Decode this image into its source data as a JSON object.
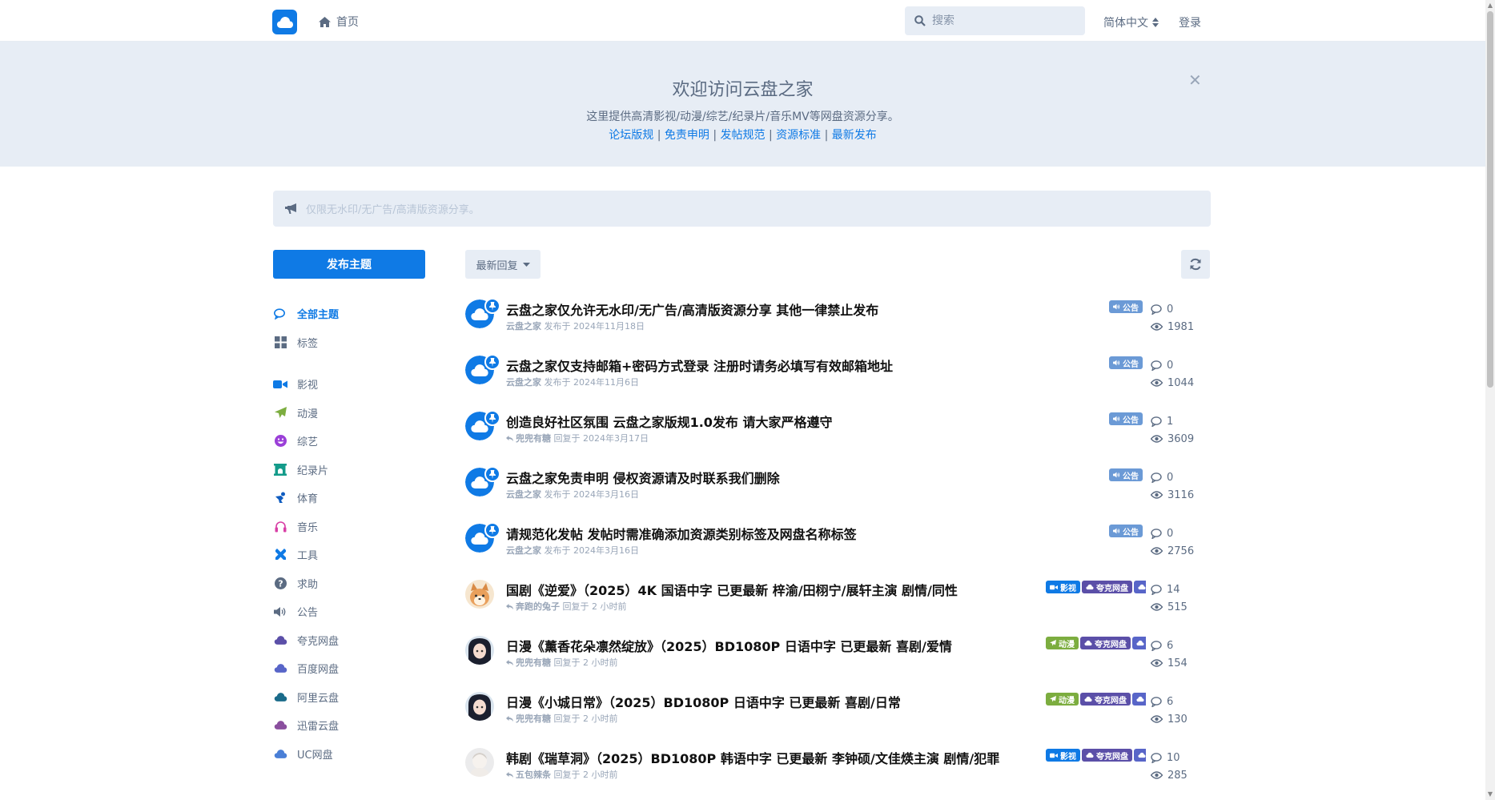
{
  "header": {
    "home_label": "首页",
    "search_placeholder": "搜索",
    "language": "简体中文",
    "login": "登录"
  },
  "hero": {
    "title": "欢迎访问云盘之家",
    "description": "这里提供高清影视/动漫/综艺/纪录片/音乐MV等网盘资源分享。",
    "links": [
      "论坛版规",
      "免责申明",
      "发帖规范",
      "资源标准",
      "最新发布"
    ],
    "separator": " | "
  },
  "announcement": {
    "text": "仅限无水印/无广告/高清版资源分享。"
  },
  "sidebar": {
    "new_topic": "发布主题",
    "items": [
      {
        "label": "全部主题",
        "icon": "comments-icon",
        "color": "#0f7ae5",
        "active": true
      },
      {
        "label": "标签",
        "icon": "grid-icon",
        "color": "#5b6b82"
      },
      {
        "label": "影视",
        "icon": "video-icon",
        "color": "#0f7ae5"
      },
      {
        "label": "动漫",
        "icon": "paper-plane-icon",
        "color": "#7cad3f"
      },
      {
        "label": "综艺",
        "icon": "laugh-icon",
        "color": "#9b3fd8"
      },
      {
        "label": "纪录片",
        "icon": "archway-icon",
        "color": "#139b8a"
      },
      {
        "label": "体育",
        "icon": "skating-icon",
        "color": "#0f5cc0"
      },
      {
        "label": "音乐",
        "icon": "headphones-icon",
        "color": "#d83fa6"
      },
      {
        "label": "工具",
        "icon": "tools-icon",
        "color": "#0f7ae5"
      },
      {
        "label": "求助",
        "icon": "question-icon",
        "color": "#5b6b82"
      },
      {
        "label": "公告",
        "icon": "volume-icon",
        "color": "#5b6b82"
      },
      {
        "label": "夸克网盘",
        "icon": "cloud-icon",
        "color": "#5b4fa8"
      },
      {
        "label": "百度网盘",
        "icon": "cloud-icon",
        "color": "#5865c8"
      },
      {
        "label": "阿里云盘",
        "icon": "cloud-icon",
        "color": "#1a6b8a"
      },
      {
        "label": "迅雷云盘",
        "icon": "cloud-icon",
        "color": "#8a4f9e"
      },
      {
        "label": "UC网盘",
        "icon": "cloud-icon",
        "color": "#4a7fd6"
      }
    ]
  },
  "toolbar": {
    "sort_label": "最新回复"
  },
  "tag_labels": {
    "announce": "公告",
    "movie": "影视",
    "anime": "动漫",
    "quark": "夸克网盘",
    "baidu": "百度网盘"
  },
  "colors": {
    "primary": "#0f7ae5",
    "tag_announce": "#6b9ad6",
    "tag_movie": "#0f7ae5",
    "tag_anime": "#7cad3f",
    "tag_quark": "#5b4fa8",
    "tag_baidu": "#5865c8"
  },
  "topics": [
    {
      "title": "云盘之家仅允许无水印/无广告/高清版资源分享 其他一律禁止发布",
      "author": "云盘之家",
      "action": "发布于",
      "time": "2024年11月18日",
      "replies": "0",
      "views": "1981",
      "pinned": true,
      "tags": [
        "announce"
      ],
      "avatar": "cloud"
    },
    {
      "title": "云盘之家仅支持邮箱+密码方式登录 注册时请务必填写有效邮箱地址",
      "author": "云盘之家",
      "action": "发布于",
      "time": "2024年11月6日",
      "replies": "0",
      "views": "1044",
      "pinned": true,
      "tags": [
        "announce"
      ],
      "avatar": "cloud"
    },
    {
      "title": "创造良好社区氛围 云盘之家版规1.0发布 请大家严格遵守",
      "author": "兜兜有糖",
      "action": "回复于",
      "time": "2024年3月17日",
      "replies": "1",
      "views": "3609",
      "pinned": true,
      "reply": true,
      "tags": [
        "announce"
      ],
      "avatar": "cloud"
    },
    {
      "title": "云盘之家免责申明 侵权资源请及时联系我们删除",
      "author": "云盘之家",
      "action": "发布于",
      "time": "2024年3月16日",
      "replies": "0",
      "views": "3116",
      "pinned": true,
      "tags": [
        "announce"
      ],
      "avatar": "cloud"
    },
    {
      "title": "请规范化发帖 发帖时需准确添加资源类别标签及网盘名称标签",
      "author": "云盘之家",
      "action": "发布于",
      "time": "2024年3月16日",
      "replies": "0",
      "views": "2756",
      "pinned": true,
      "tags": [
        "announce"
      ],
      "avatar": "cloud"
    },
    {
      "title": "国剧《逆爱》（2025）4K 国语中字 已更最新 梓渝/田栩宁/展轩主演 剧情/同性",
      "author": "奔跑的兔子",
      "action": "回复于",
      "time": "2 小时前",
      "replies": "14",
      "views": "515",
      "reply": true,
      "tags": [
        "movie",
        "quark",
        "baidu"
      ],
      "avatar": "dog"
    },
    {
      "title": "日漫《薰香花朵凛然绽放》（2025）BD1080P 日语中字 已更最新 喜剧/爱情",
      "author": "兜兜有糖",
      "action": "回复于",
      "time": "2 小时前",
      "replies": "6",
      "views": "154",
      "reply": true,
      "tags": [
        "anime",
        "quark",
        "baidu"
      ],
      "avatar": "girl"
    },
    {
      "title": "日漫《小城日常》（2025）BD1080P 日语中字 已更最新 喜剧/日常",
      "author": "兜兜有糖",
      "action": "回复于",
      "time": "2 小时前",
      "replies": "6",
      "views": "130",
      "reply": true,
      "tags": [
        "anime",
        "quark",
        "baidu"
      ],
      "avatar": "girl"
    },
    {
      "title": "韩剧《瑞草洞》（2025）BD1080P 韩语中字 已更最新 李钟硕/文佳煐主演 剧情/犯罪",
      "author": "五包辣条",
      "action": "回复于",
      "time": "2 小时前",
      "replies": "10",
      "views": "285",
      "reply": true,
      "tags": [
        "movie",
        "quark",
        "baidu"
      ],
      "avatar": "light"
    }
  ]
}
